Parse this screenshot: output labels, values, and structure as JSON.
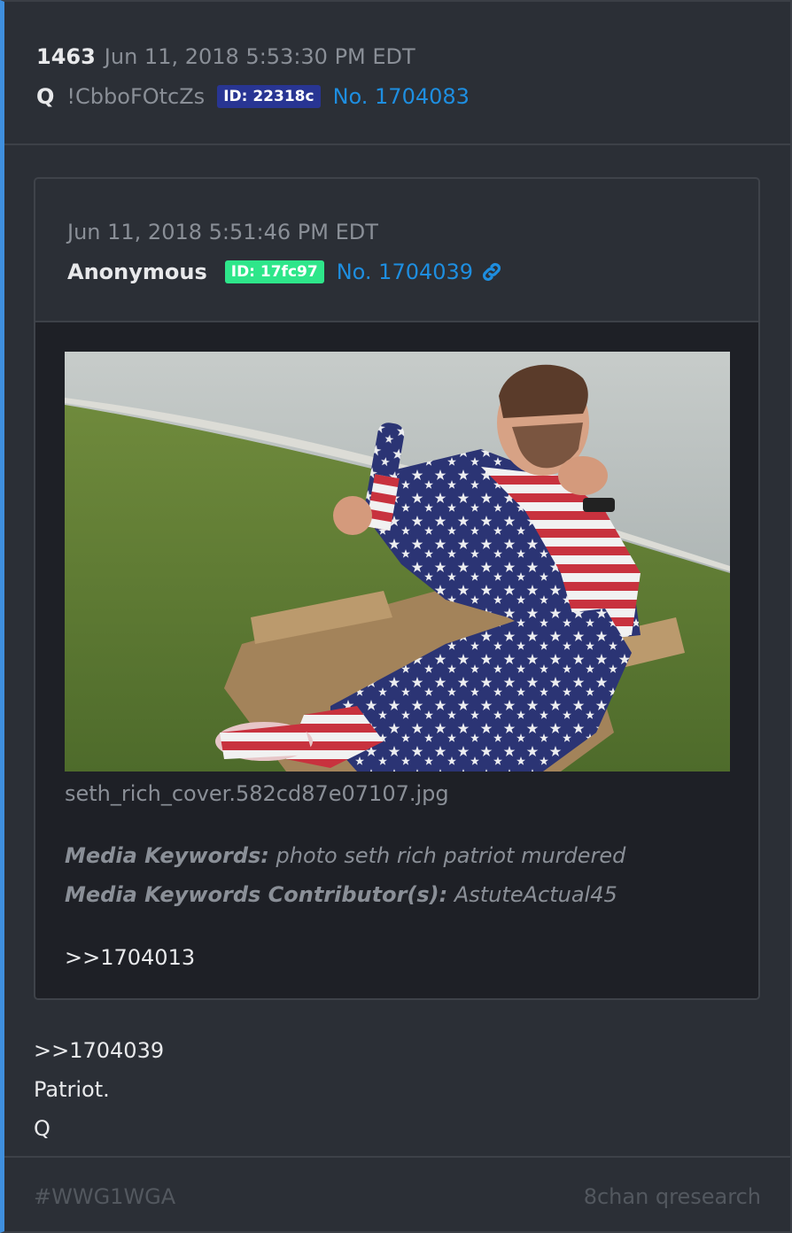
{
  "post": {
    "number": "1463",
    "date": "Jun 11, 2018 5:53:30 PM EDT",
    "author": "Q",
    "tripcode": "!CbboFOtcZs",
    "id_badge": "ID: 22318c",
    "post_no": "No. 1704083",
    "body_lines": [
      ">>1704039",
      "Patriot.",
      "Q"
    ]
  },
  "quoted_post": {
    "date": "Jun 11, 2018 5:51:46 PM EDT",
    "author": "Anonymous",
    "id_badge": "ID: 17fc97",
    "post_no": "No. 1704039",
    "link_icon": "link-icon",
    "image_filename": "seth_rich_cover.582cd87e07107.jpg",
    "keywords_label": "Media Keywords:",
    "keywords_value": " photo seth rich patriot murdered",
    "contributors_label": "Media Keywords Contributor(s):",
    "contributors_value": " AstuteActual45",
    "quote_ref": ">>1704013"
  },
  "footer": {
    "hashtag": "#WWG1WGA",
    "source": "8chan qresearch"
  },
  "colors": {
    "accent_border": "#3f8fde",
    "link": "#1e8ee0",
    "id_q_bg": "#283593",
    "id_anon_bg": "#2ee68a"
  }
}
